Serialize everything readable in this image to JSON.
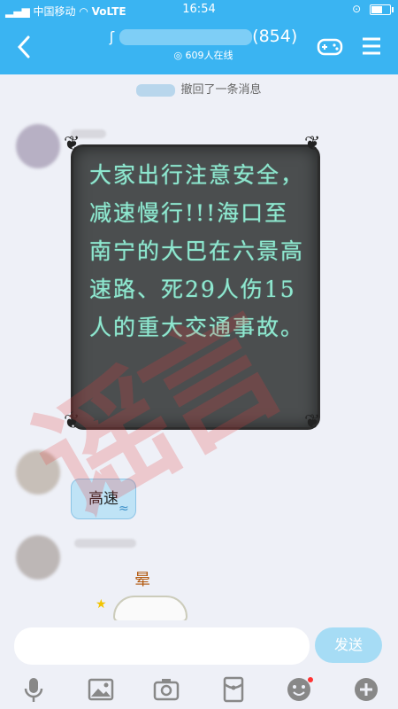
{
  "status_bar": {
    "carrier": "中国移动",
    "network": "VoLTE",
    "time": "16:54"
  },
  "header": {
    "title_suffix": "(854)",
    "online": "609人在线",
    "icons": [
      "back-arrow-icon",
      "gamepad-icon",
      "menu-icon"
    ]
  },
  "recall_notice": "撤回了一条消息",
  "messages": {
    "board_text": "大家出行注意安全，减速慢行!!!海口至南宁的大巴在六景高速路、死29人伤15人的重大交通事故。",
    "bubble_text": "高速",
    "sticker_text": "晕"
  },
  "input": {
    "placeholder": "",
    "send_label": "发送"
  },
  "watermark": "谣言",
  "colors": {
    "header": "#3ab4f2",
    "board": "#4b4e4f",
    "chalk": "#8fe7cf",
    "send": "#a6dcf5"
  }
}
